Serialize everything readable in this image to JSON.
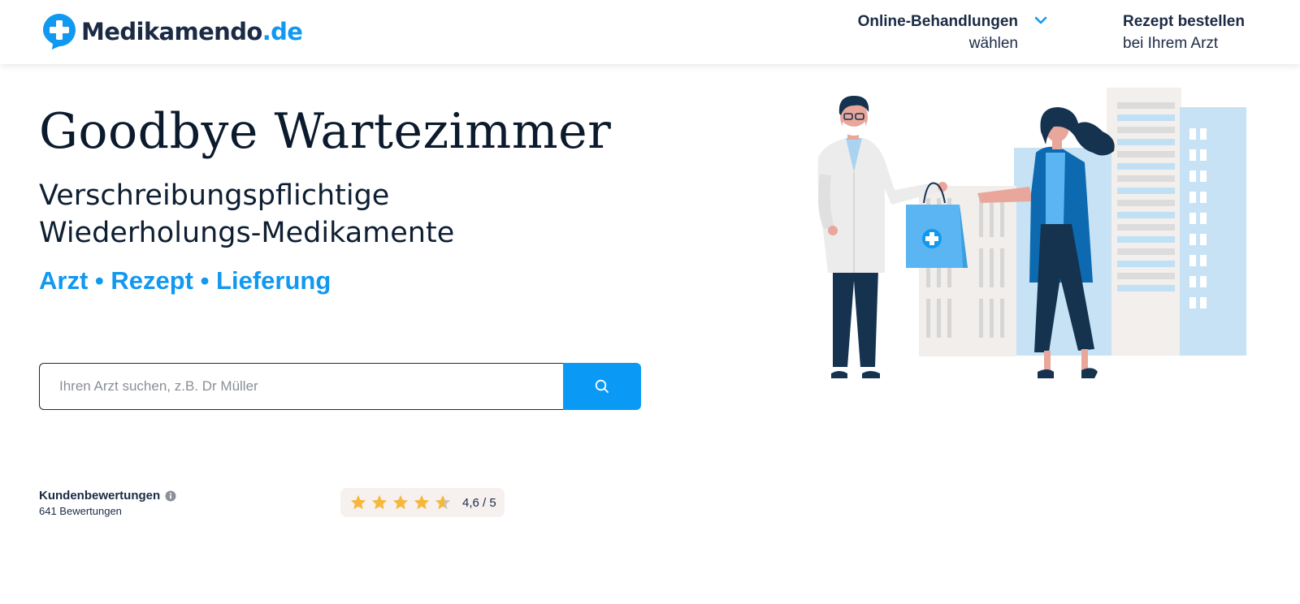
{
  "brand": {
    "name": "Medikamendo",
    "tld": ".de",
    "color": "#1198f0",
    "dark": "#1b2b45"
  },
  "nav": {
    "treatments": {
      "line1": "Online-Behandlungen",
      "line2": "wählen",
      "icon": "chevron-down-icon"
    },
    "prescription": {
      "line1": "Rezept bestellen",
      "line2": "bei Ihrem Arzt"
    }
  },
  "hero": {
    "title": "Goodbye Wartezimmer",
    "subtitle_line1": "Verschreibungspflichtige",
    "subtitle_line2": "Wiederholungs-Medikamente",
    "tagline": "Arzt • Rezept • Lieferung"
  },
  "search": {
    "placeholder": "Ihren Arzt suchen, z.B. Dr Müller",
    "value": "",
    "button_icon": "search-icon",
    "button_color": "#0a9af5"
  },
  "reviews": {
    "title": "Kundenbewertungen",
    "count": "641 Bewertungen",
    "rating_text": "4,6 / 5",
    "rating": 4.6,
    "max": 5,
    "star_color": "#f5b83d"
  }
}
